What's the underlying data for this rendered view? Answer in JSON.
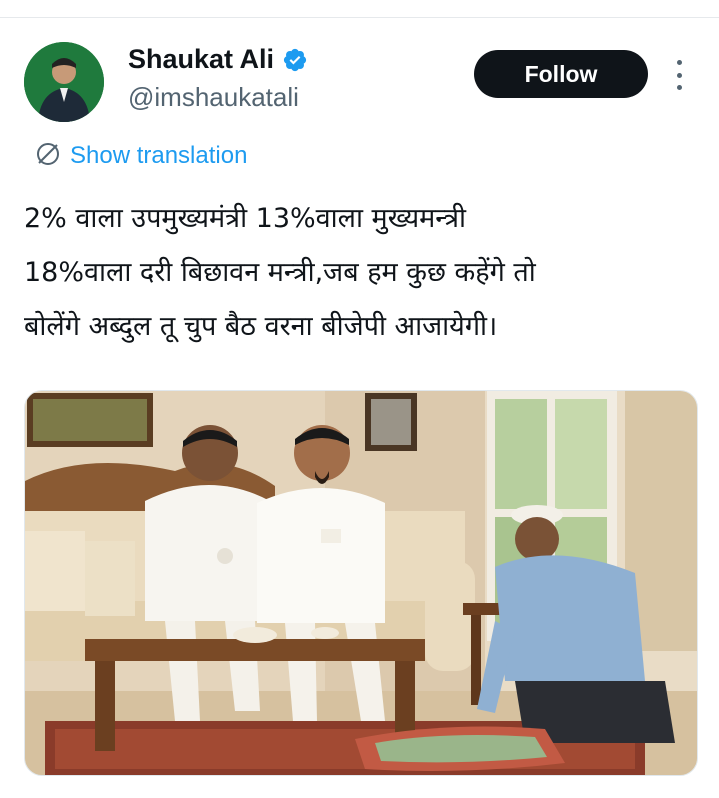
{
  "author": {
    "display_name": "Shaukat Ali",
    "handle": "@imshaukatali",
    "verified": true,
    "avatar_icon": "profile-avatar",
    "avatar_bg": "#1f7a3d"
  },
  "actions": {
    "follow_label": "Follow",
    "more_icon": "more-vertical-icon"
  },
  "translation": {
    "label": "Show translation",
    "icon": "globe-translate-icon",
    "color": "#1d9bf0"
  },
  "tweet": {
    "lines": [
      "2% वाला उपमुख्यमंत्री 13%वाला मुख्यमन्त्री",
      "18%वाला दरी बिछावन मन्त्री,जब हम कुछ कहेंगे तो",
      "बोलेंगे अब्दुल तू चुप बैठ वरना बीजेपी आजायेगी।"
    ]
  },
  "media": {
    "type": "image",
    "subject": "illustration"
  },
  "colors": {
    "accent": "#1d9bf0",
    "text_primary": "#0f1419",
    "text_secondary": "#536471",
    "follow_bg": "#0f1419"
  }
}
